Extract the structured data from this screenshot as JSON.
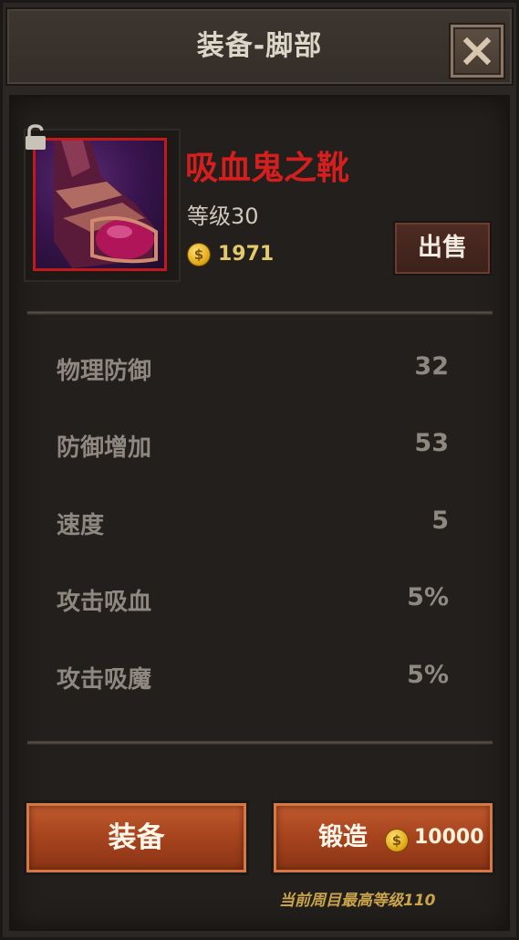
{
  "header": {
    "title": "装备-脚部"
  },
  "item": {
    "name": "吸血鬼之靴",
    "level_text": "等级30",
    "price": "1971",
    "sell_label": "出售"
  },
  "stats": [
    {
      "label": "物理防御",
      "value": "32"
    },
    {
      "label": "防御增加",
      "value": "53"
    },
    {
      "label": "速度",
      "value": "5"
    },
    {
      "label": "攻击吸血",
      "value": "5%"
    },
    {
      "label": "攻击吸魔",
      "value": "5%"
    }
  ],
  "actions": {
    "equip_label": "装备",
    "forge_label": "锻造",
    "forge_cost": "10000"
  },
  "footer_note": "当前周目最高等级110",
  "colors": {
    "item_name": "#d41f1f",
    "item_border": "#c21a1a",
    "button_orange": "#a8451f",
    "coin_gold": "#e2a814"
  }
}
